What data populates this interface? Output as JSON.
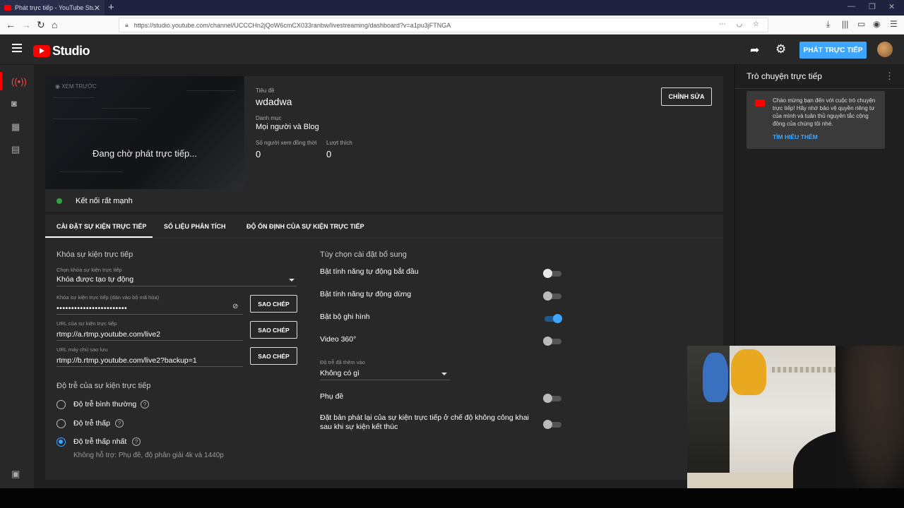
{
  "browser": {
    "tab_title": "Phát trực tiếp - YouTube Studio",
    "url": "https://studio.youtube.com/channel/UCCCHn2jQoW6cmCX033ranbw/livestreaming/dashboard?v=a1pu3jFTNGA"
  },
  "header": {
    "logo_text": "Studio",
    "go_live_label": "PHÁT TRỰC TIẾP"
  },
  "preview": {
    "label": "XEM TRƯỚC",
    "waiting_text": "Đang chờ phát trực tiếp...",
    "connection_text": "Kết nối rất mạnh"
  },
  "stream_info": {
    "title_label": "Tiêu đề",
    "title": "wdadwa",
    "category_label": "Danh mục",
    "category": "Mọi người và Blog",
    "viewers_label": "Số người xem đồng thời",
    "viewers": "0",
    "likes_label": "Lượt thích",
    "likes": "0",
    "edit_label": "CHỈNH SỬA"
  },
  "tabs": [
    {
      "label": "CÀI ĐẶT SỰ KIỆN TRỰC TIẾP",
      "active": true
    },
    {
      "label": "SỐ LIỆU PHÂN TÍCH",
      "active": false
    },
    {
      "label": "ĐỘ ỔN ĐỊNH CỦA SỰ KIỆN TRỰC TIẾP",
      "active": false
    }
  ],
  "stream_key": {
    "section_title": "Khóa sự kiện trực tiếp",
    "select_label": "Chọn khóa sự kiện trực tiếp",
    "select_value": "Khóa được tạo tự động",
    "key_label": "Khóa sự kiện trực tiếp (dán vào bộ mã hóa)",
    "key_value": "••••••••••••••••••••••••",
    "url_label": "URL của sự kiện trực tiếp",
    "url_value": "rtmp://a.rtmp.youtube.com/live2",
    "backup_label": "URL máy chủ sao lưu",
    "backup_value": "rtmp://b.rtmp.youtube.com/live2?backup=1",
    "copy_label": "SAO CHÉP"
  },
  "latency": {
    "section_title": "Độ trễ của sự kiện trực tiếp",
    "options": [
      {
        "label": "Độ trễ bình thường",
        "selected": false
      },
      {
        "label": "Độ trễ thấp",
        "selected": false
      },
      {
        "label": "Độ trễ thấp nhất",
        "selected": true
      }
    ],
    "note": "Không hỗ trợ: Phụ đề, độ phân giải 4k và 1440p"
  },
  "additional": {
    "section_title": "Tùy chọn cài đặt bổ sung",
    "options": [
      {
        "label": "Bật tính năng tự động bắt đầu",
        "on": false
      },
      {
        "label": "Bật tính năng tự động dừng",
        "on": false
      },
      {
        "label": "Bật bộ ghi hình",
        "on": true
      },
      {
        "label": "Video 360°",
        "on": false
      }
    ],
    "delay_label": "Độ trễ đã thêm vào",
    "delay_value": "Không có gì",
    "captions_label": "Phụ đề",
    "captions_on": false,
    "unlisted_label_1": "Đặt bản phát lại của sự kiện trực tiếp ở chế độ không công khai",
    "unlisted_label_2": "sau khi sự kiện kết thúc",
    "unlisted_on": false
  },
  "chat": {
    "title": "Trò chuyện trực tiếp",
    "welcome": "Chào mừng bạn đến với cuộc trò chuyện trực tiếp! Hãy nhớ bảo vệ quyền riêng tư của mình và tuân thủ nguyên tắc cộng đồng của chúng tôi nhé.",
    "learn_more": "TÌM HIỂU THÊM"
  },
  "colors": {
    "accent": "#3ea6ff",
    "brand_red": "#ff0000",
    "connection_green": "#2ba640"
  }
}
